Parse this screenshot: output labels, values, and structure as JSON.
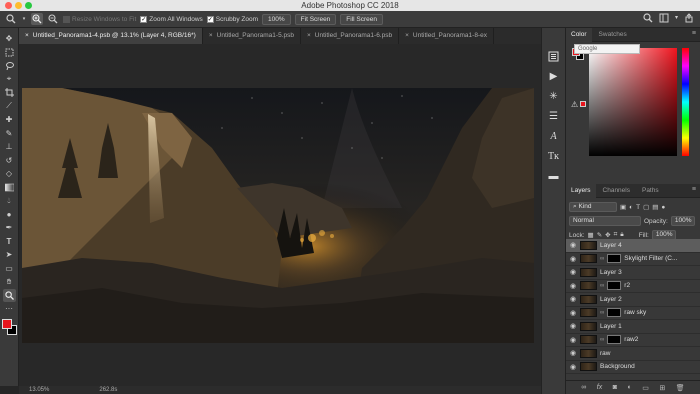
{
  "app": {
    "title": "Adobe Photoshop CC 2018"
  },
  "options": {
    "resize_label": "Resize Windows to Fit",
    "zoom_all_label": "Zoom All Windows",
    "scrubby_label": "Scrubby Zoom",
    "zoom_value": "100%",
    "fit_screen": "Fit Screen",
    "fill_screen": "Fill Screen"
  },
  "tabs": [
    {
      "label": "Untitled_Panorama1-4.psb @ 13.1% (Layer 4, RGB/16*)",
      "close": "×"
    },
    {
      "label": "Untitled_Panorama1-5.psb",
      "close": "×"
    },
    {
      "label": "Untitled_Panorama1-6.psb",
      "close": "×"
    },
    {
      "label": "Untitled_Panorama1-8-ex",
      "close": "×"
    }
  ],
  "status": {
    "zoom": "13.05%",
    "doc": "262.8s"
  },
  "color_panel": {
    "tab_color": "Color",
    "tab_swatches": "Swatches",
    "google_tip": "Google",
    "fg_color": "#e8141c",
    "bg_color": "#000000"
  },
  "layers_panel": {
    "tab_layers": "Layers",
    "tab_channels": "Channels",
    "tab_paths": "Paths",
    "kind": "Kind",
    "blend_mode": "Normal",
    "opacity_label": "Opacity:",
    "opacity": "100%",
    "lock_label": "Lock:",
    "fill_label": "Fill:",
    "fill": "100%",
    "layers": [
      {
        "name": "Layer 4",
        "selected": true,
        "mask": false
      },
      {
        "name": "Skylight Filter (C...",
        "selected": false,
        "mask": true
      },
      {
        "name": "Layer 3",
        "selected": false,
        "mask": false
      },
      {
        "name": "r2",
        "selected": false,
        "mask": true
      },
      {
        "name": "Layer 2",
        "selected": false,
        "mask": false
      },
      {
        "name": "raw sky",
        "selected": false,
        "mask": true
      },
      {
        "name": "Layer 1",
        "selected": false,
        "mask": false
      },
      {
        "name": "raw2",
        "selected": false,
        "mask": true
      },
      {
        "name": "raw",
        "selected": false,
        "mask": false
      },
      {
        "name": "Background",
        "selected": false,
        "mask": false
      }
    ]
  }
}
